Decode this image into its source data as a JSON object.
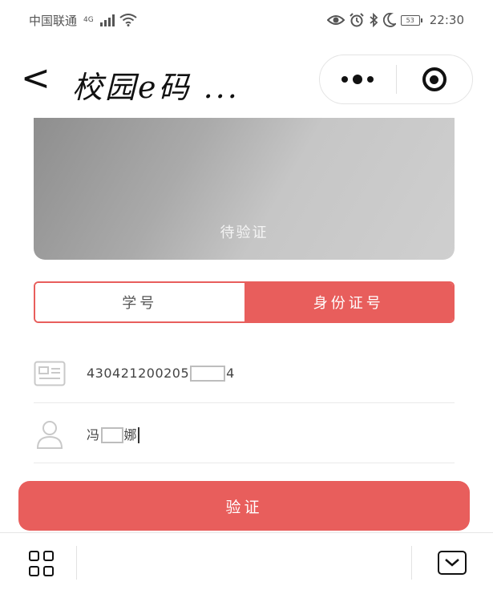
{
  "status_bar": {
    "carrier": "中国联通",
    "network": "4G",
    "battery": "53",
    "time": "22:30"
  },
  "nav": {
    "back_label": "<",
    "title": "校园e码 ..."
  },
  "card": {
    "status_text": "待验证"
  },
  "tabs": [
    {
      "label": "学号",
      "active": false
    },
    {
      "label": "身份证号",
      "active": true
    }
  ],
  "form": {
    "id_number": {
      "prefix": "430421200205",
      "suffix": "4"
    },
    "name": {
      "prefix": "冯",
      "suffix": "娜"
    }
  },
  "verify_button": {
    "label": "验证"
  },
  "icons": {
    "back": "chevron-left-icon",
    "more": "more-dots-icon",
    "close": "target-icon",
    "id_card": "id-card-icon",
    "user": "user-icon",
    "grid": "grid-icon",
    "collapse": "collapse-icon"
  },
  "colors": {
    "accent": "#e85e5c",
    "card_gradient_dark": "#8e8e8e",
    "card_gradient_light": "#cfcfcf"
  }
}
